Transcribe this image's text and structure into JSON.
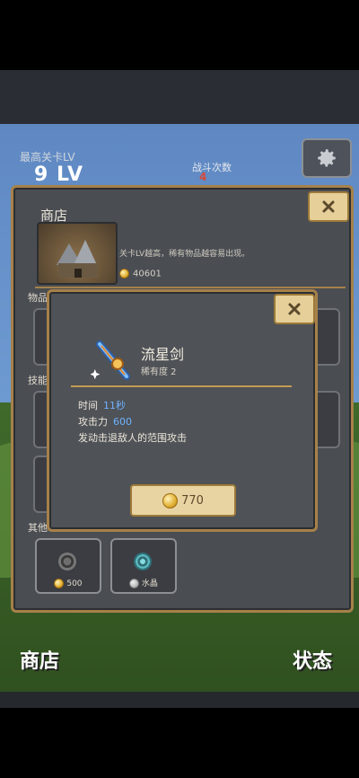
{
  "hud": {
    "stage_label": "最高关卡LV",
    "stage_level": "9 LV",
    "battle_label": "战斗次数",
    "battle_count": "4"
  },
  "bottom_nav": {
    "shop_label": "商店",
    "status_label": "状态"
  },
  "shop": {
    "title": "商店",
    "description": "关卡LV越高，稀有物品越容易出现。",
    "gold": "40601",
    "sections": {
      "items": "物品",
      "skills": "技能",
      "other": "其他"
    },
    "other_items": [
      {
        "price": "500",
        "icon": "ring-icon"
      },
      {
        "price": "水晶",
        "icon": "swirl-icon"
      }
    ]
  },
  "item_popup": {
    "name": "流星剑",
    "rarity_label": "稀有度 2",
    "stats": [
      {
        "label": "时间",
        "value": "11秒"
      },
      {
        "label": "攻击力",
        "value": "600"
      },
      {
        "label": "发动击退敌人的范围攻击",
        "value": ""
      }
    ],
    "price": "770"
  },
  "colors": {
    "panel_bg": "#4a4d52",
    "panel_border": "#a6814a",
    "button_bg": "#e6cf98",
    "stat_value": "#6fb3ff",
    "battle_value": "#d64a3a"
  }
}
